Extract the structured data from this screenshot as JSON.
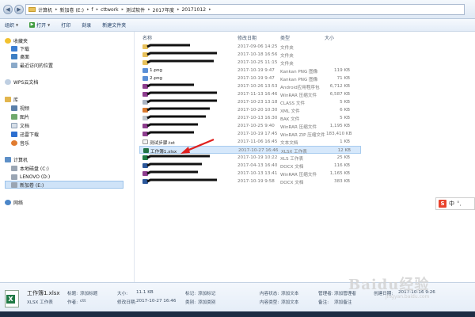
{
  "address": {
    "crumbs": [
      "计算机",
      "新加卷 (E:)",
      "f",
      "cttwork",
      "测试软件",
      "2017年度",
      "20171012"
    ]
  },
  "toolbar": {
    "organize": "组织",
    "open": "打开",
    "print": "打印",
    "burn": "刻录",
    "new_folder": "新建文件夹"
  },
  "nav": {
    "favorites": "收藏夹",
    "downloads": "下载",
    "desktop": "桌面",
    "recent": "最近访问的位置",
    "wps": "WPS云文档",
    "libraries": "库",
    "videos": "视频",
    "pictures": "图片",
    "documents": "文档",
    "thunder": "迅雷下载",
    "music": "音乐",
    "computer": "计算机",
    "local_c": "本地磁盘 (C:)",
    "lenovo_d": "LENOVO (D:)",
    "new_e": "新加卷 (E:)",
    "network": "网络"
  },
  "columns": {
    "name": "名称",
    "date": "修改日期",
    "type": "类型",
    "size": "大小"
  },
  "files": [
    {
      "name": "",
      "date": "2017-09-06 14:25",
      "type": "文件夹",
      "size": "",
      "icon": "folder",
      "redacted": true
    },
    {
      "name": "",
      "date": "2017-10-18 16:56",
      "type": "文件夹",
      "size": "",
      "icon": "folder",
      "redacted": true
    },
    {
      "name": "",
      "date": "2017-10-25 11:15",
      "type": "文件夹",
      "size": "",
      "icon": "folder",
      "redacted": true
    },
    {
      "name": "1.png",
      "date": "2017-10-19 9:47",
      "type": "Kankan PNG 图像",
      "size": "119 KB",
      "icon": "png",
      "redacted": false
    },
    {
      "name": "2.png",
      "date": "2017-10-19 9:47",
      "type": "Kankan PNG 图像",
      "size": "71 KB",
      "icon": "png",
      "redacted": false
    },
    {
      "name": "",
      "date": "2017-10-26 13:53",
      "type": "Android应用程序包",
      "size": "6,712 KB",
      "icon": "rar",
      "redacted": true
    },
    {
      "name": "",
      "date": "2017-11-13 16:46",
      "type": "WinRAR 压缩文件",
      "size": "6,587 KB",
      "icon": "rar",
      "redacted": true
    },
    {
      "name": "",
      "date": "2017-10-23 13:18",
      "type": "CLASS 文件",
      "size": "5 KB",
      "icon": "class",
      "redacted": true
    },
    {
      "name": "",
      "date": "2017-10-20 10:30",
      "type": "XML 文件",
      "size": "6 KB",
      "icon": "xml",
      "redacted": true
    },
    {
      "name": "",
      "date": "2017-10-13 16:30",
      "type": "BAK 文件",
      "size": "5 KB",
      "icon": "bak",
      "redacted": true
    },
    {
      "name": "",
      "date": "2017-10-25 9:40",
      "type": "WinRAR 压缩文件",
      "size": "1,195 KB",
      "icon": "rar",
      "redacted": true
    },
    {
      "name": "",
      "date": "2017-10-19 17:45",
      "type": "WinRAR ZIP 压缩文件",
      "size": "183,410 KB",
      "icon": "rar",
      "redacted": true
    },
    {
      "name": "测试步骤.txt",
      "date": "2017-11-06 16:45",
      "type": "文本文档",
      "size": "1 KB",
      "icon": "txt",
      "redacted": false
    },
    {
      "name": "工作簿1.xlsx",
      "date": "2017-10-27 16:46",
      "type": "XLSX 工作表",
      "size": "12 KB",
      "icon": "xlsx",
      "redacted": false,
      "selected": true
    },
    {
      "name": "",
      "date": "2017-10-19 10:22",
      "type": "XLS 工作表",
      "size": "25 KB",
      "icon": "xls",
      "redacted": true
    },
    {
      "name": "",
      "date": "2017-04-13 16:40",
      "type": "DOCX 文档",
      "size": "116 KB",
      "icon": "docx",
      "redacted": true
    },
    {
      "name": "",
      "date": "2017-10-13 13:41",
      "type": "WinRAR 压缩文件",
      "size": "1,165 KB",
      "icon": "rar",
      "redacted": true
    },
    {
      "name": "",
      "date": "2017-10-19 9:58",
      "type": "DOCX 文档",
      "size": "383 KB",
      "icon": "docx",
      "redacted": true
    }
  ],
  "ime": {
    "label": "中",
    "extra": "°,"
  },
  "details": {
    "filename": "工作簿1.xlsx",
    "title_label": "标题:",
    "title_value": "添加标题",
    "type": "XLSX 工作表",
    "author_label": "作者:",
    "author_value": "ctt",
    "size_label": "大小:",
    "size_value": "11.1 KB",
    "modified_label": "修改日期:",
    "modified_value": "2017-10-27 16:46",
    "tags_label": "标记:",
    "tags_value": "添加标记",
    "category_label": "类别:",
    "category_value": "添加类别",
    "content_status_label": "内容状态:",
    "content_status_value": "添加文本",
    "content_type_label": "内容类型:",
    "content_type_value": "添加文本",
    "manager_label": "管理者:",
    "manager_value": "添加管理者",
    "comment_label": "备注:",
    "comment_value": "添加备注",
    "created_label": "创建日期:",
    "created_value": "2017-10-16 9:26"
  },
  "watermark": {
    "text": "Baidu经验",
    "sub": "jingyan.baidu.com"
  },
  "colors": {
    "selection": "#d6e8fb",
    "arrow": "#e0201e",
    "toolbar_top": "#f6f9fd"
  }
}
